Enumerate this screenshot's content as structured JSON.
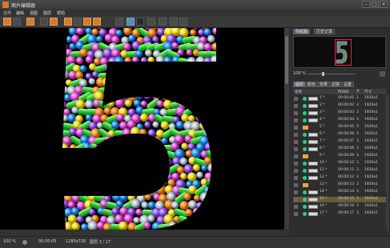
{
  "app": {
    "title": "图片编辑器",
    "window_buttons": [
      "–",
      "□",
      "×"
    ]
  },
  "menubar": {
    "items": [
      "文件",
      "编辑",
      "视图",
      "图层",
      "帮助"
    ]
  },
  "toolbar": {
    "tool_icons": [
      "new-icon",
      "open-icon",
      "save-icon",
      "crop-icon",
      "rotate-icon",
      "flip-icon",
      "grid-icon",
      "layers-icon",
      "zoom-icon",
      "brush-icon",
      "eraser-icon",
      "text-icon"
    ]
  },
  "right_panel": {
    "top_tabs": [
      "导航器",
      "历史记录"
    ],
    "zoom_label": "100 %",
    "list_tabs": [
      "图层",
      "颜色",
      "效果",
      "滤镜",
      "设置"
    ],
    "list_header": {
      "name": "名称",
      "time": "时间码",
      "count": "#",
      "size": "尺寸"
    },
    "rows": [
      {
        "name": "1 *",
        "time": "00:00:01",
        "count": "1",
        "size": "1920x1",
        "type": "item"
      },
      {
        "name": "2 *",
        "time": "00:00:02",
        "count": "3",
        "size": "1920x1",
        "type": "item"
      },
      {
        "name": "3 *",
        "time": "00:00:03",
        "count": "3",
        "size": "1920x1",
        "type": "item"
      },
      {
        "name": "4 *",
        "time": "00:00:04",
        "count": "3",
        "size": "1920x1",
        "type": "item"
      },
      {
        "name": "5 *",
        "time": "00:00:05",
        "count": "3",
        "size": "1920x1",
        "type": "folder"
      },
      {
        "name": "6 *",
        "time": "00:00:06",
        "count": "3",
        "size": "1920x1",
        "type": "item"
      },
      {
        "name": "7 *",
        "time": "00:00:07",
        "count": "3",
        "size": "1920x1",
        "type": "item"
      },
      {
        "name": "8 *",
        "time": "00:00:08",
        "count": "3",
        "size": "1920x1",
        "type": "item"
      },
      {
        "name": "9 *",
        "time": "00:00:09",
        "count": "3",
        "size": "1920x1",
        "type": "folder"
      },
      {
        "name": "10 *",
        "time": "00:00:10",
        "count": "3",
        "size": "1920x1",
        "type": "item"
      },
      {
        "name": "11 *",
        "time": "00:00:11",
        "count": "3",
        "size": "1920x1",
        "type": "item"
      },
      {
        "name": "12 *",
        "time": "00:00:12",
        "count": "3",
        "size": "1920x1",
        "type": "item"
      },
      {
        "name": "13 *",
        "time": "00:00:13",
        "count": "3",
        "size": "1920x1",
        "type": "folder"
      },
      {
        "name": "14 *",
        "time": "00:00:14",
        "count": "3",
        "size": "1920x1",
        "type": "item"
      },
      {
        "name": "15 *",
        "time": "00:00:15",
        "count": "3",
        "size": "1920x1",
        "type": "item",
        "selected": true
      },
      {
        "name": "16 *",
        "time": "00:00:16",
        "count": "3",
        "size": "1920x1",
        "type": "item"
      },
      {
        "name": "17 *",
        "time": "00:00:17",
        "count": "3",
        "size": "1920x1",
        "type": "item"
      }
    ]
  },
  "statusbar": {
    "zoom": "100 %",
    "time": "00:00:05",
    "size": "1280x720",
    "info": "图层 3 / 17"
  },
  "colors": {
    "accent": "#d77a2e",
    "selection": "#6a5a3c",
    "status_dot": "#2ec98a"
  }
}
